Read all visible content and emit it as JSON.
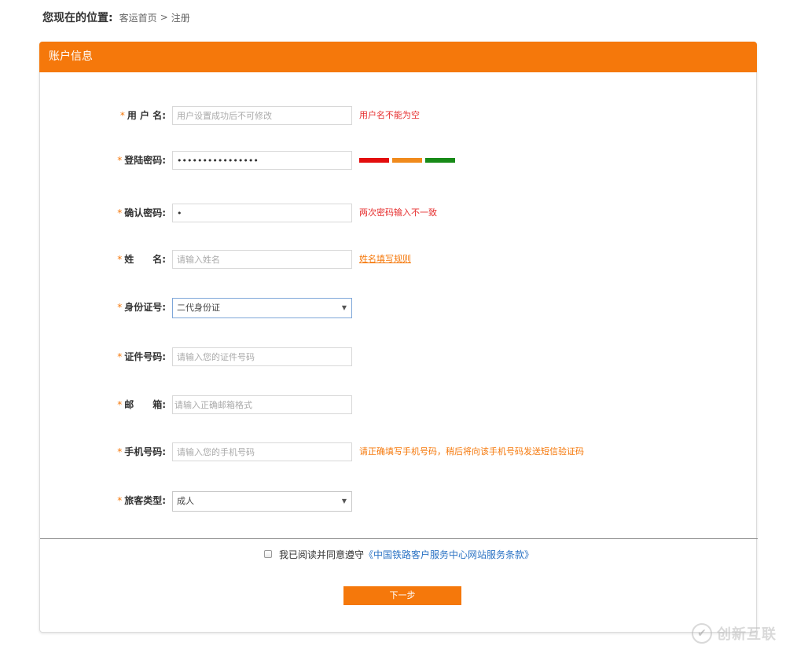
{
  "breadcrumb": {
    "label": "您现在的位置:",
    "home": "客运首页",
    "separator": ">",
    "current": "注册"
  },
  "panel": {
    "title": "账户信息"
  },
  "colors": {
    "accent": "#f5780b",
    "error": "#e62e2e",
    "link": "#2b73c4"
  },
  "form": {
    "required_mark": "*",
    "username": {
      "label": "用 户 名:",
      "placeholder": "用户设置成功后不可修改",
      "hint": "用户名不能为空"
    },
    "password": {
      "label": "登陆密码:",
      "value": "••••••••••••••••",
      "strength_colors": [
        "#e30d0d",
        "#f08a1c",
        "#178a17"
      ]
    },
    "confirm_password": {
      "label": "确认密码:",
      "value": "•",
      "hint": "两次密码输入不一致"
    },
    "name": {
      "label": "姓　　名:",
      "placeholder": "请输入姓名",
      "hint": "姓名填写规则"
    },
    "id_type": {
      "label": "身份证号:",
      "selected": "二代身份证"
    },
    "id_number": {
      "label": "证件号码:",
      "placeholder": "请输入您的证件号码"
    },
    "email": {
      "label": "邮　　箱:",
      "placeholder": "请输入正确邮箱格式"
    },
    "phone": {
      "label": "手机号码:",
      "placeholder": "请输入您的手机号码",
      "hint": "请正确填写手机号码，稍后将向该手机号码发送短信验证码"
    },
    "passenger_type": {
      "label": "旅客类型:",
      "selected": "成人"
    }
  },
  "agreement": {
    "text": "我已阅读并同意遵守",
    "terms": "《中国铁路客户服务中心网站服务条款》"
  },
  "next_button": "下一步",
  "watermark": {
    "text": "创新互联"
  }
}
